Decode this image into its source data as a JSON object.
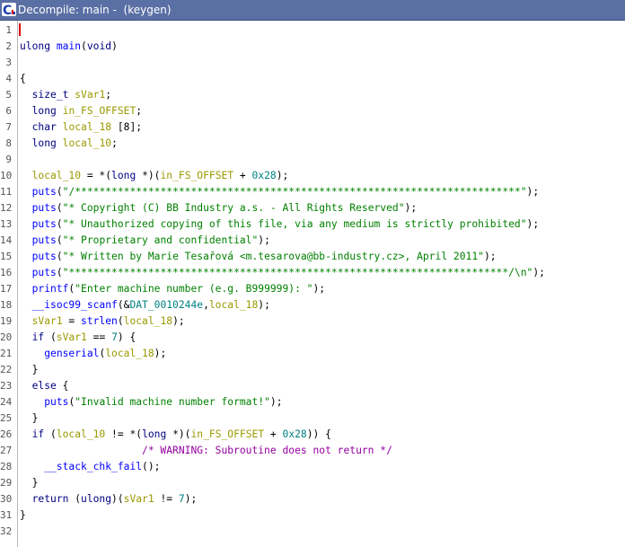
{
  "window": {
    "title": "Decompile: main -  (keygen)",
    "icon": "ghidra-decompile-icon"
  },
  "code": {
    "lines": [
      {
        "n": "1",
        "tokens": []
      },
      {
        "n": "2",
        "tokens": [
          [
            "ty",
            "ulong"
          ],
          [
            "p",
            " "
          ],
          [
            "fn",
            "main"
          ],
          [
            "p",
            "("
          ],
          [
            "ty",
            "void"
          ],
          [
            "p",
            ")"
          ]
        ]
      },
      {
        "n": "3",
        "tokens": []
      },
      {
        "n": "4",
        "tokens": [
          [
            "p",
            "{"
          ]
        ]
      },
      {
        "n": "5",
        "tokens": [
          [
            "p",
            "  "
          ],
          [
            "ty",
            "size_t"
          ],
          [
            "p",
            " "
          ],
          [
            "var",
            "sVar1"
          ],
          [
            "p",
            ";"
          ]
        ]
      },
      {
        "n": "6",
        "tokens": [
          [
            "p",
            "  "
          ],
          [
            "ty",
            "long"
          ],
          [
            "p",
            " "
          ],
          [
            "var",
            "in_FS_OFFSET"
          ],
          [
            "p",
            ";"
          ]
        ]
      },
      {
        "n": "7",
        "tokens": [
          [
            "p",
            "  "
          ],
          [
            "ty",
            "char"
          ],
          [
            "p",
            " "
          ],
          [
            "var",
            "local_18"
          ],
          [
            "p",
            " [8];"
          ]
        ]
      },
      {
        "n": "8",
        "tokens": [
          [
            "p",
            "  "
          ],
          [
            "ty",
            "long"
          ],
          [
            "p",
            " "
          ],
          [
            "var",
            "local_10"
          ],
          [
            "p",
            ";"
          ]
        ]
      },
      {
        "n": "9",
        "tokens": []
      },
      {
        "n": "10",
        "tokens": [
          [
            "p",
            "  "
          ],
          [
            "var",
            "local_10"
          ],
          [
            "p",
            " = *("
          ],
          [
            "ty",
            "long"
          ],
          [
            "p",
            " *)("
          ],
          [
            "var",
            "in_FS_OFFSET"
          ],
          [
            "p",
            " + "
          ],
          [
            "num",
            "0x28"
          ],
          [
            "p",
            ");"
          ]
        ]
      },
      {
        "n": "11",
        "tokens": [
          [
            "p",
            "  "
          ],
          [
            "fn",
            "puts"
          ],
          [
            "p",
            "("
          ],
          [
            "str",
            "\"/*************************************************************************\""
          ],
          [
            "p",
            ");"
          ]
        ]
      },
      {
        "n": "12",
        "tokens": [
          [
            "p",
            "  "
          ],
          [
            "fn",
            "puts"
          ],
          [
            "p",
            "("
          ],
          [
            "str",
            "\"* Copyright (C) BB Industry a.s. - All Rights Reserved\""
          ],
          [
            "p",
            ");"
          ]
        ]
      },
      {
        "n": "13",
        "tokens": [
          [
            "p",
            "  "
          ],
          [
            "fn",
            "puts"
          ],
          [
            "p",
            "("
          ],
          [
            "str",
            "\"* Unauthorized copying of this file, via any medium is strictly prohibited\""
          ],
          [
            "p",
            ");"
          ]
        ]
      },
      {
        "n": "14",
        "tokens": [
          [
            "p",
            "  "
          ],
          [
            "fn",
            "puts"
          ],
          [
            "p",
            "("
          ],
          [
            "str",
            "\"* Proprietary and confidential\""
          ],
          [
            "p",
            ");"
          ]
        ]
      },
      {
        "n": "15",
        "tokens": [
          [
            "p",
            "  "
          ],
          [
            "fn",
            "puts"
          ],
          [
            "p",
            "("
          ],
          [
            "str",
            "\"* Written by Marie Tesařová <m.tesarova@bb-industry.cz>, April 2011\""
          ],
          [
            "p",
            ");"
          ]
        ]
      },
      {
        "n": "16",
        "tokens": [
          [
            "p",
            "  "
          ],
          [
            "fn",
            "puts"
          ],
          [
            "p",
            "("
          ],
          [
            "str",
            "\"************************************************************************/\\n\""
          ],
          [
            "p",
            ");"
          ]
        ]
      },
      {
        "n": "17",
        "tokens": [
          [
            "p",
            "  "
          ],
          [
            "fn",
            "printf"
          ],
          [
            "p",
            "("
          ],
          [
            "str",
            "\"Enter machine number (e.g. B999999): \""
          ],
          [
            "p",
            ");"
          ]
        ]
      },
      {
        "n": "18",
        "tokens": [
          [
            "p",
            "  "
          ],
          [
            "fn",
            "__isoc99_scanf"
          ],
          [
            "p",
            "(&"
          ],
          [
            "gvar",
            "DAT_0010244e"
          ],
          [
            "p",
            ","
          ],
          [
            "var",
            "local_18"
          ],
          [
            "p",
            ");"
          ]
        ]
      },
      {
        "n": "19",
        "tokens": [
          [
            "p",
            "  "
          ],
          [
            "var",
            "sVar1"
          ],
          [
            "p",
            " = "
          ],
          [
            "fn",
            "strlen"
          ],
          [
            "p",
            "("
          ],
          [
            "var",
            "local_18"
          ],
          [
            "p",
            ");"
          ]
        ]
      },
      {
        "n": "20",
        "tokens": [
          [
            "p",
            "  "
          ],
          [
            "kw",
            "if"
          ],
          [
            "p",
            " ("
          ],
          [
            "var",
            "sVar1"
          ],
          [
            "p",
            " == "
          ],
          [
            "num",
            "7"
          ],
          [
            "p",
            ") {"
          ]
        ]
      },
      {
        "n": "21",
        "tokens": [
          [
            "p",
            "    "
          ],
          [
            "fn",
            "genserial"
          ],
          [
            "p",
            "("
          ],
          [
            "var",
            "local_18"
          ],
          [
            "p",
            ");"
          ]
        ]
      },
      {
        "n": "22",
        "tokens": [
          [
            "p",
            "  }"
          ]
        ]
      },
      {
        "n": "23",
        "tokens": [
          [
            "p",
            "  "
          ],
          [
            "kw",
            "else"
          ],
          [
            "p",
            " {"
          ]
        ]
      },
      {
        "n": "24",
        "tokens": [
          [
            "p",
            "    "
          ],
          [
            "fn",
            "puts"
          ],
          [
            "p",
            "("
          ],
          [
            "str",
            "\"Invalid machine number format!\""
          ],
          [
            "p",
            ");"
          ]
        ]
      },
      {
        "n": "25",
        "tokens": [
          [
            "p",
            "  }"
          ]
        ]
      },
      {
        "n": "26",
        "tokens": [
          [
            "p",
            "  "
          ],
          [
            "kw",
            "if"
          ],
          [
            "p",
            " ("
          ],
          [
            "var",
            "local_10"
          ],
          [
            "p",
            " != *("
          ],
          [
            "ty",
            "long"
          ],
          [
            "p",
            " *)("
          ],
          [
            "var",
            "in_FS_OFFSET"
          ],
          [
            "p",
            " + "
          ],
          [
            "num",
            "0x28"
          ],
          [
            "p",
            ")) {"
          ]
        ]
      },
      {
        "n": "27",
        "tokens": [
          [
            "p",
            "                    "
          ],
          [
            "cm",
            "/* WARNING: Subroutine does not return */"
          ]
        ]
      },
      {
        "n": "28",
        "tokens": [
          [
            "p",
            "    "
          ],
          [
            "fn",
            "__stack_chk_fail"
          ],
          [
            "p",
            "();"
          ]
        ]
      },
      {
        "n": "29",
        "tokens": [
          [
            "p",
            "  }"
          ]
        ]
      },
      {
        "n": "30",
        "tokens": [
          [
            "p",
            "  "
          ],
          [
            "kw",
            "return"
          ],
          [
            "p",
            " ("
          ],
          [
            "ty",
            "ulong"
          ],
          [
            "p",
            ")("
          ],
          [
            "var",
            "sVar1"
          ],
          [
            "p",
            " != "
          ],
          [
            "num",
            "7"
          ],
          [
            "p",
            ");"
          ]
        ]
      },
      {
        "n": "31",
        "tokens": [
          [
            "p",
            "}"
          ]
        ]
      },
      {
        "n": "32",
        "tokens": []
      }
    ]
  },
  "colors": {
    "titlebar": "#5a6fa4",
    "keyword": "#000080",
    "function": "#0000ff",
    "variable": "#999900",
    "global": "#008080",
    "string": "#008000",
    "comment": "#9400a0",
    "cursor": "#e00000"
  }
}
